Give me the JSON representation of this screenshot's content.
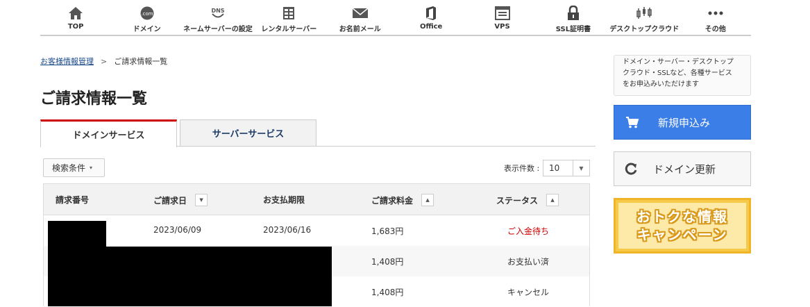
{
  "nav": [
    {
      "label": "TOP",
      "icon": "home-icon"
    },
    {
      "label": "ドメイン",
      "icon": "domain-com-icon",
      "icon_text": ".com"
    },
    {
      "label": "ネームサーバーの設定",
      "icon": "dns-icon",
      "icon_text": "DNS"
    },
    {
      "label": "レンタルサーバー",
      "icon": "server-icon"
    },
    {
      "label": "お名前メール",
      "icon": "mail-icon"
    },
    {
      "label": "Office",
      "icon": "office-icon"
    },
    {
      "label": "VPS",
      "icon": "vps-icon"
    },
    {
      "label": "SSL証明書",
      "icon": "lock-icon"
    },
    {
      "label": "デスクトップクラウド",
      "icon": "chart-icon"
    },
    {
      "label": "その他",
      "icon": "more-icon"
    }
  ],
  "breadcrumb": {
    "home": "お客様情報管理",
    "separator": ">",
    "current": "ご請求情報一覧"
  },
  "page_title": "ご請求情報一覧",
  "tabs": {
    "domain": "ドメインサービス",
    "server": "サーバーサービス"
  },
  "filter": {
    "label": "検索条件",
    "caret": "▾"
  },
  "per_page": {
    "label": "表示件数 :",
    "value": "10"
  },
  "table": {
    "headers": {
      "number": "請求番号",
      "date": "ご請求日",
      "due": "お支払期限",
      "amount": "ご請求料金",
      "status": "ステータス"
    },
    "rows": [
      {
        "number": "",
        "date": "2023/06/09",
        "due": "2023/06/16",
        "amount": "1,683円",
        "status": "ご入金待ち"
      },
      {
        "number": "",
        "date": "",
        "due": "",
        "amount": "1,408円",
        "status": "お支払い済"
      },
      {
        "number": "",
        "date": "",
        "due": "",
        "amount": "1,408円",
        "status": "キャンセル"
      }
    ]
  },
  "sidebar": {
    "info_lines": [
      "ドメイン・サーバー・デスクトップ",
      "クラウド・SSLなど、各種サービス",
      "をお申込みいただけます"
    ],
    "new_label": "新規申込み",
    "renew_label": "ドメイン更新",
    "campaign_lines": [
      "おトクな情報",
      "キャンペーン"
    ]
  },
  "colors": {
    "accent_blue": "#3b7ee8",
    "active_tab_red": "#cc0000",
    "campaign_yellow": "#f7c948",
    "status_red": "#cc0000"
  }
}
